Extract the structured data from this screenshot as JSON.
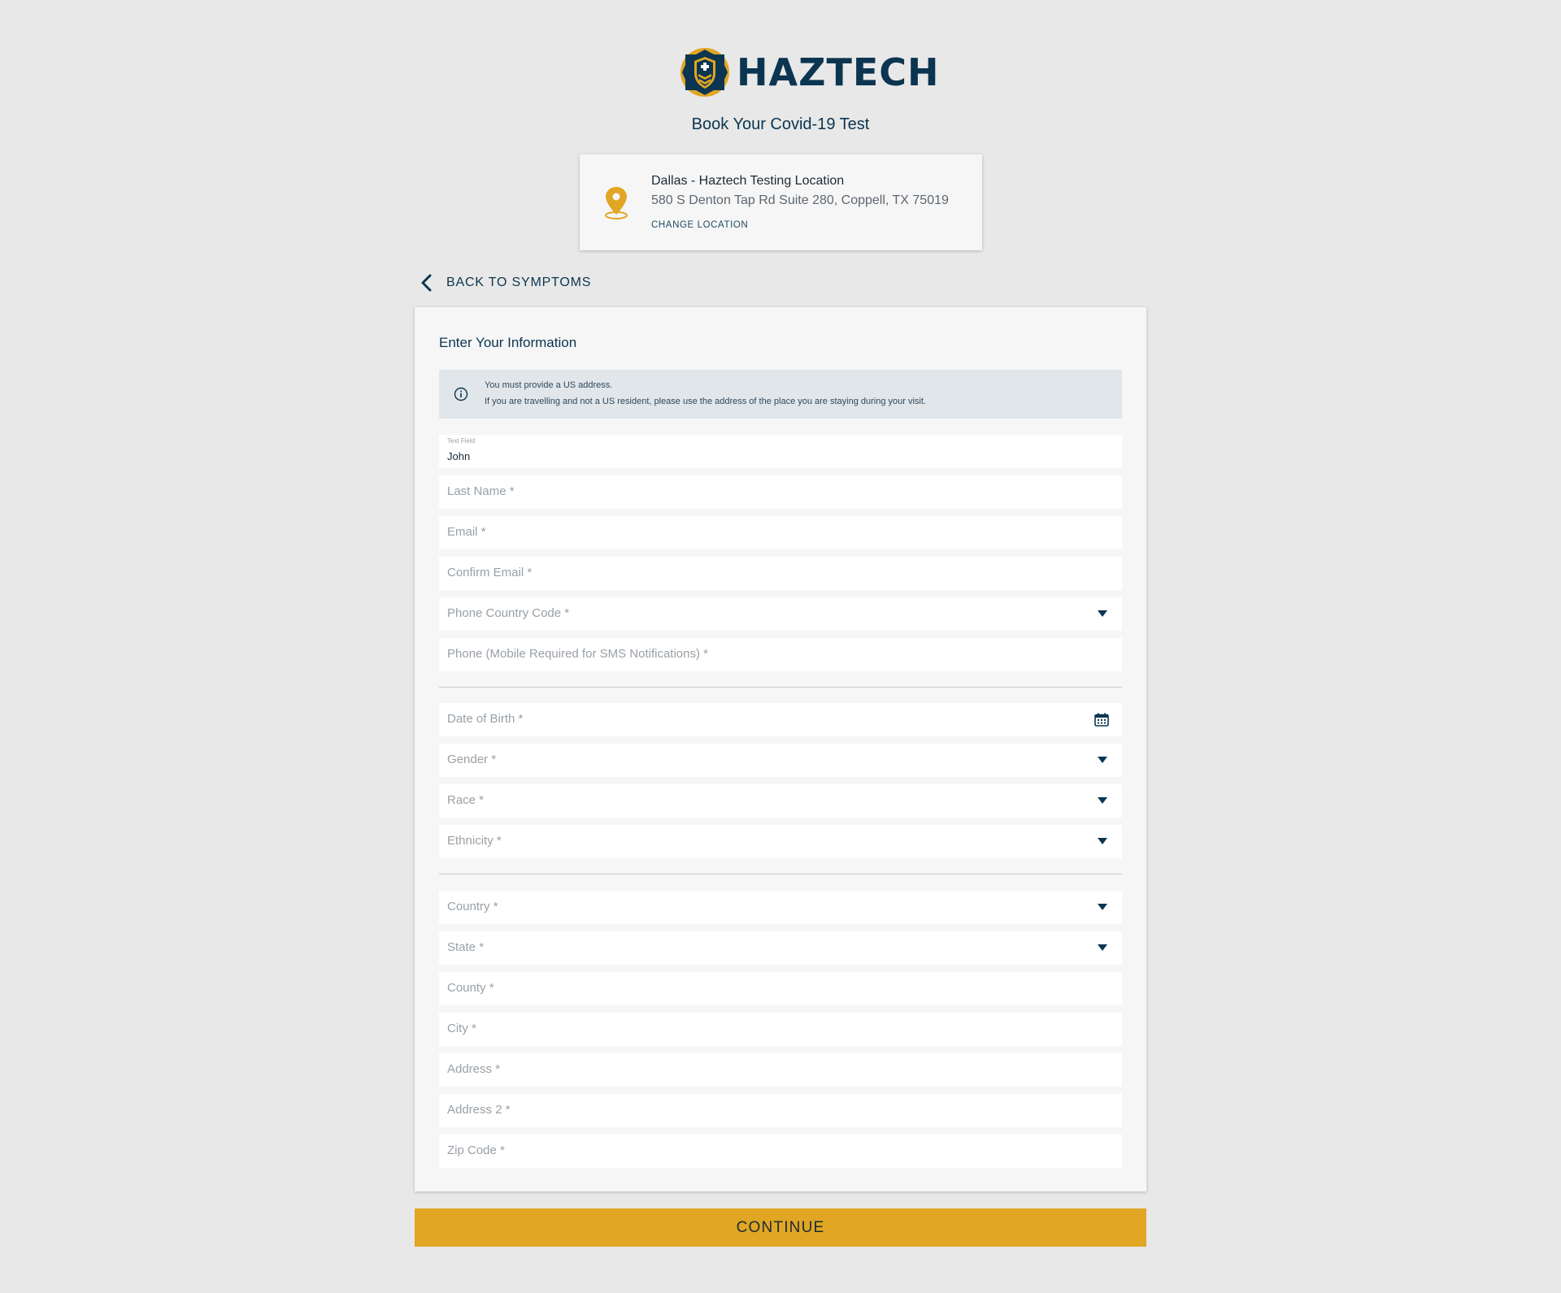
{
  "brand": {
    "name": "HAZTECH",
    "primary": "#0b3550",
    "accent": "#e0a624"
  },
  "header": {
    "title": "Book Your Covid-19 Test"
  },
  "location": {
    "name": "Dallas - Haztech Testing Location",
    "address": "580 S Denton Tap Rd Suite 280, Coppell, TX 75019",
    "change_label": "CHANGE LOCATION",
    "icon": "map-pin-icon"
  },
  "back": {
    "label": "BACK TO SYMPTOMS",
    "icon": "chevron-left-icon"
  },
  "form": {
    "title": "Enter Your Information",
    "notice": {
      "icon": "info-icon",
      "line1": "You must provide a US address.",
      "line2": "If you are travelling and not a US resident, please use the address of the place you are staying during your visit."
    },
    "first_name": {
      "label": "Text Field",
      "value": "John"
    },
    "last_name": {
      "placeholder": "Last Name *"
    },
    "email": {
      "placeholder": "Email *"
    },
    "confirm_email": {
      "placeholder": "Confirm Email *"
    },
    "phone_country_code": {
      "placeholder": "Phone Country Code *"
    },
    "phone": {
      "placeholder": "Phone (Mobile Required for SMS Notifications) *"
    },
    "dob": {
      "placeholder": "Date of Birth *"
    },
    "gender": {
      "placeholder": "Gender *"
    },
    "race": {
      "placeholder": "Race *"
    },
    "ethnicity": {
      "placeholder": "Ethnicity *"
    },
    "country": {
      "placeholder": "Country *"
    },
    "state": {
      "placeholder": "State *"
    },
    "county": {
      "placeholder": "County *"
    },
    "city": {
      "placeholder": "City *"
    },
    "address": {
      "placeholder": "Address *"
    },
    "address2": {
      "placeholder": "Address 2 *"
    },
    "zip": {
      "placeholder": "Zip Code *"
    }
  },
  "continue_label": "CONTINUE"
}
